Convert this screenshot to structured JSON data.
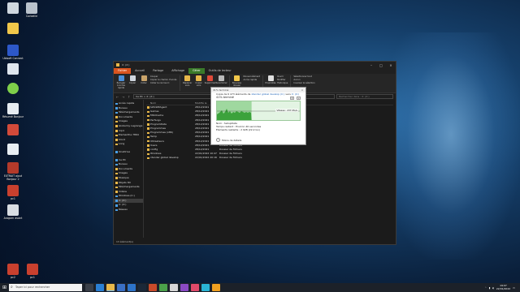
{
  "desktop": {
    "icons_col1": [
      "Corbeille",
      "",
      "",
      "",
      "",
      "",
      "",
      "",
      "",
      "",
      "",
      "",
      "",
      ""
    ],
    "labels": [
      {
        "text": "Corbeille"
      },
      {
        "text": ""
      },
      {
        "text": ""
      },
      {
        "text": ""
      },
      {
        "text": ""
      },
      {
        "text": "Ubisoft Connect"
      },
      {
        "text": ""
      },
      {
        "text": ""
      },
      {
        "text": "Résumé Bonjour"
      },
      {
        "text": ""
      },
      {
        "text": ""
      },
      {
        "text": ""
      },
      {
        "text": "EXTRAIT ajout Bonjour 2"
      },
      {
        "text": "pc1"
      },
      {
        "text": "pc2"
      },
      {
        "text": "Aragorn avant"
      }
    ],
    "second_col": [
      "Vidéos"
    ]
  },
  "explorer": {
    "title": "X: (X:)",
    "tabs": [
      "Fichier",
      "Accueil",
      "Partage",
      "Affichage",
      "Outils de lecteur"
    ],
    "tool_tab": "Gérer",
    "ribbon": {
      "clipboard": [
        "Épingler à Accès rapide",
        "Copier",
        "Coller"
      ],
      "clipboard_small": [
        "Couper",
        "Copier le chemin d'accès",
        "Coller le raccourci"
      ],
      "organize": [
        "Déplacer vers",
        "Copier vers",
        "Supprimer",
        "Renommer"
      ],
      "new": [
        "Nouveau dossier"
      ],
      "new_small": [
        "Nouvel élément",
        "Accès rapide"
      ],
      "open": [
        "Propriétés"
      ],
      "open_small": [
        "Ouvrir",
        "Modifier",
        "Historique"
      ],
      "select_small": [
        "Sélectionner tout",
        "Aucun",
        "Inverser la sélection"
      ],
      "groups": [
        "Presse-papiers",
        "Organiser",
        "Nouveau",
        "Ouvrir",
        "Sélectionner"
      ]
    },
    "address": {
      "path": "Ce PC > X: (X:)",
      "search_placeholder": "Rechercher dans : X: (X:)"
    },
    "nav": [
      {
        "label": "Accès rapide",
        "type": "star"
      },
      {
        "label": "Bureau",
        "type": "blue"
      },
      {
        "label": "Téléchargements",
        "type": "blue"
      },
      {
        "label": "Documents",
        "type": "folder"
      },
      {
        "label": "Images",
        "type": "folder"
      },
      {
        "label": "Global by Lagrange Fr.x64",
        "type": "folder"
      },
      {
        "label": "mp4",
        "type": "folder"
      },
      {
        "label": "Elementhe 7864",
        "type": "folder"
      },
      {
        "label": "blocd",
        "type": "folder"
      },
      {
        "label": "Long",
        "type": "folder"
      },
      {
        "label": "OneDrive",
        "type": "blue"
      },
      {
        "label": "Ce PC",
        "type": "blue"
      },
      {
        "label": "Bureau",
        "type": "blue"
      },
      {
        "label": "Documents",
        "type": "folder"
      },
      {
        "label": "Images",
        "type": "folder"
      },
      {
        "label": "Musique",
        "type": "folder"
      },
      {
        "label": "Objets 3D",
        "type": "folder"
      },
      {
        "label": "Téléchargements",
        "type": "folder"
      },
      {
        "label": "Vidéos",
        "type": "folder"
      },
      {
        "label": "Windows (C:)",
        "type": "blue"
      },
      {
        "label": "X: (X:)",
        "type": "blue",
        "selected": true
      },
      {
        "label": "X: (X:)",
        "type": "blue"
      },
      {
        "label": "Réseau",
        "type": "blue"
      }
    ],
    "columns": [
      "Nom",
      "Modifié le",
      "Type"
    ],
    "files": [
      {
        "name": "$WinREAgent",
        "date": "28/12/2021",
        "type": "Dossier de fichiers"
      },
      {
        "name": "Games",
        "date": "28/12/2021",
        "type": "Dossier de fichiers"
      },
      {
        "name": "MSOCache",
        "date": "28/12/2021",
        "type": "Dossier de fichiers"
      },
      {
        "name": "PerfLogs",
        "date": "28/12/2021",
        "type": "Dossier de fichiers"
      },
      {
        "name": "ProgramData",
        "date": "28/12/2021",
        "type": "Dossier de fichiers"
      },
      {
        "name": "Programmes",
        "date": "28/12/2021",
        "type": "Dossier de fichiers"
      },
      {
        "name": "Programmes (x86)",
        "date": "28/12/2021",
        "type": "Dossier de fichiers"
      },
      {
        "name": "Temp",
        "date": "28/12/2021",
        "type": "Dossier de fichiers"
      },
      {
        "name": "Utilisateurs",
        "date": "28/12/2021",
        "type": "Dossier de fichiers"
      },
      {
        "name": "Users",
        "date": "28/12/2021",
        "type": "Dossier de fichiers"
      },
      {
        "name": "config",
        "date": "28/12/2021",
        "type": "Dossier de fichiers"
      },
      {
        "name": "Windows",
        "date": "22/01/2022 10:47",
        "type": "Dossier de fichiers"
      },
      {
        "name": "xtender global develop",
        "date": "22/01/2022 20:16",
        "type": "Dossier de fichiers"
      }
    ],
    "status": "13 élément(s)"
  },
  "copy_dialog": {
    "title": "41% terminé",
    "line1_prefix": "Copie de 6 473 éléments de",
    "line1_source": "xtender global develop (C:)",
    "line1_mid": "vers",
    "line1_dest": "X: (X:)",
    "percent": "41% terminé",
    "pause": "II",
    "close": "×",
    "speed": "Vitesse : 237 Mo/s",
    "progress": 0.41,
    "name": "Nom : SetupData",
    "time_left": "Temps restant : Environ 40 secondes",
    "items_left": "Éléments restants : 2 928 (22,2 Go)",
    "less_details": "Moins de détails"
  },
  "taskbar": {
    "search_placeholder": "Taper ici pour rechercher",
    "time": "19:07",
    "date": "22/01/2022",
    "apps": [
      "task-view",
      "edge",
      "explorer",
      "store",
      "mail",
      "steam",
      "app7",
      "app8",
      "app9",
      "app10",
      "app11",
      "app12",
      "app13"
    ]
  },
  "colors": {
    "file_tab": "#d9541e",
    "tools_tab": "#3a7a2a",
    "progress": "#3ca23c",
    "link": "#1a5fb4"
  }
}
